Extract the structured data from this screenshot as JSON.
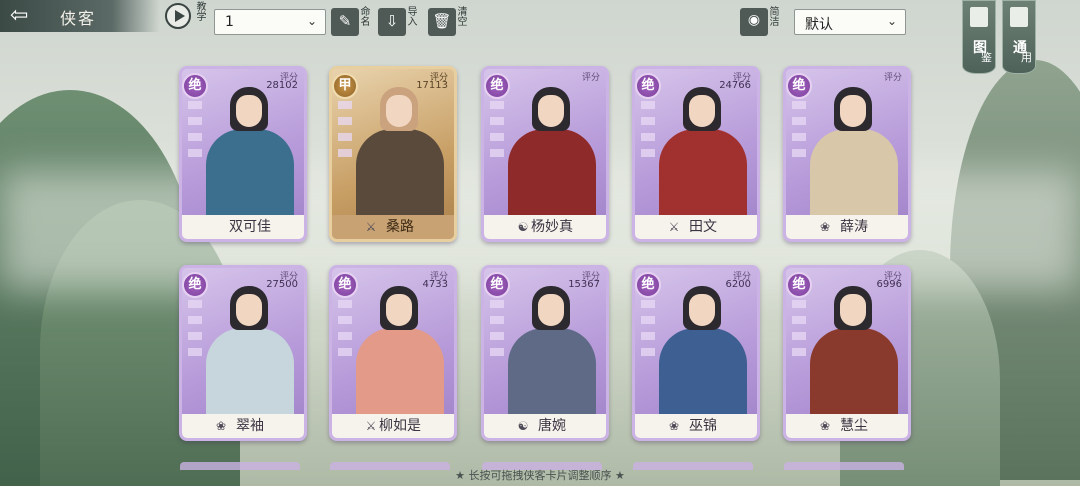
{
  "header": {
    "title": "侠客",
    "teach_label": "教学",
    "team_select_value": "1",
    "rename_label": "命名",
    "import_label": "导入",
    "clear_label": "清空",
    "simple_label": "简洁",
    "sort_select_value": "默认"
  },
  "side_tabs": [
    {
      "label": "图",
      "sub": "鉴"
    },
    {
      "label": "通",
      "sub": "用"
    }
  ],
  "cards": [
    {
      "name": "双可佳",
      "rank": "绝",
      "score_label": "评分",
      "score": "28102",
      "school_icon": "",
      "robe": "#3c6f8e",
      "rarity": "purple"
    },
    {
      "name": "桑路",
      "rank": "甲",
      "score_label": "评分",
      "score": "17113",
      "school_icon": "sword-icon",
      "robe": "#5a4a3c",
      "rarity": "gold"
    },
    {
      "name": "杨妙真",
      "rank": "绝",
      "score_label": "评分",
      "score": "",
      "school_icon": "yinyang-icon",
      "robe": "#8e2a2a",
      "rarity": "purple"
    },
    {
      "name": "田文",
      "rank": "绝",
      "score_label": "评分",
      "score": "24766",
      "school_icon": "sword-icon",
      "robe": "#a1312f",
      "rarity": "purple"
    },
    {
      "name": "薛涛",
      "rank": "绝",
      "score_label": "评分",
      "score": "",
      "school_icon": "lotus-icon",
      "robe": "#d8c7a8",
      "rarity": "purple"
    },
    {
      "name": "翠袖",
      "rank": "绝",
      "score_label": "评分",
      "score": "27500",
      "school_icon": "lotus-icon",
      "robe": "#c6d6dc",
      "rarity": "purple"
    },
    {
      "name": "柳如是",
      "rank": "绝",
      "score_label": "评分",
      "score": "4733",
      "school_icon": "sword-icon",
      "robe": "#e39a88",
      "rarity": "purple"
    },
    {
      "name": "唐婉",
      "rank": "绝",
      "score_label": "评分",
      "score": "15367",
      "school_icon": "yinyang-icon",
      "robe": "#5f6a86",
      "rarity": "purple"
    },
    {
      "name": "巫锦",
      "rank": "绝",
      "score_label": "评分",
      "score": "6200",
      "school_icon": "lotus-icon",
      "robe": "#3e5f92",
      "rarity": "purple"
    },
    {
      "name": "慧尘",
      "rank": "绝",
      "score_label": "评分",
      "score": "6996",
      "school_icon": "lotus-icon",
      "robe": "#8a3a2c",
      "rarity": "purple"
    }
  ],
  "footer": {
    "hint": "★ 长按可拖拽侠客卡片调整顺序 ★"
  }
}
